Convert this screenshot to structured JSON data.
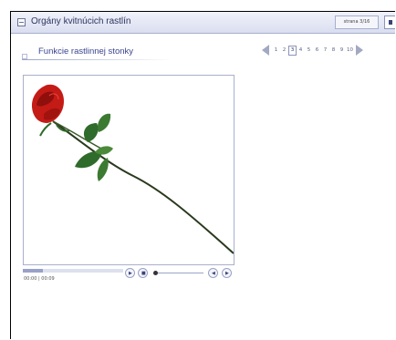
{
  "header": {
    "title": "Orgány kvitnúcich rastlín",
    "page_indicator": "strana 3/16"
  },
  "section": {
    "subtitle": "Funkcie rastlinnej stonky"
  },
  "pager": {
    "pages": [
      "1",
      "2",
      "3",
      "4",
      "5",
      "6",
      "7",
      "8",
      "9",
      "10"
    ],
    "active_page": "3"
  },
  "media": {
    "image_name": "rose-stem-image",
    "time": "00:00 | 00:09",
    "progress": 0.2
  },
  "colors": {
    "accent": "#2e3460",
    "title_bar": "#d9def0",
    "border": "#a7afcf",
    "rose": "#c41b16",
    "leaf": "#2f6b2a"
  }
}
